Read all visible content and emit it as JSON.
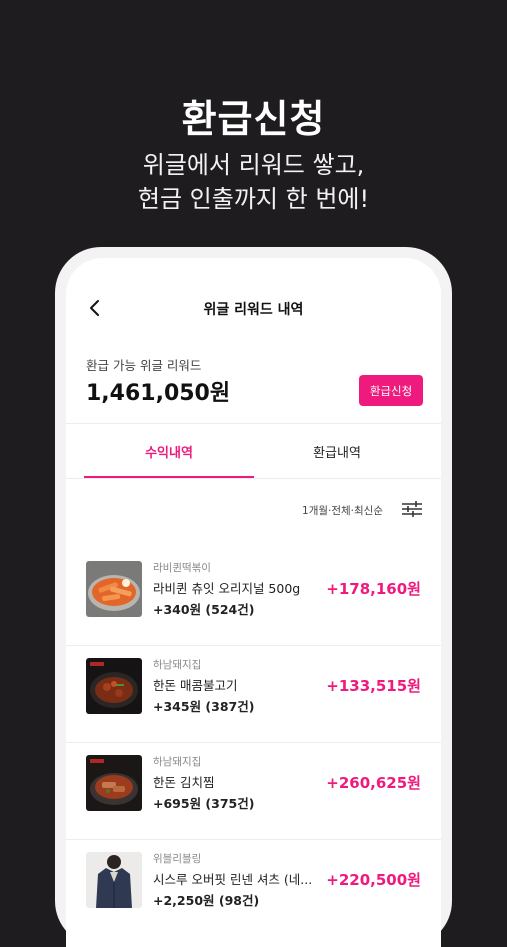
{
  "promo": {
    "title": "환급신청",
    "subtitle_line1": "위글에서 리워드 쌓고,",
    "subtitle_line2": "현금 인출까지 한 번에!"
  },
  "screen": {
    "nav_title": "위글 리워드 내역",
    "balance_label": "환급 가능 위글 리워드",
    "balance_amount": "1,461,050원",
    "refund_button": "환급신청",
    "tabs": [
      {
        "label": "수익내역",
        "active": true
      },
      {
        "label": "환급내역",
        "active": false
      }
    ],
    "filter_label": "1개월·전체·최신순",
    "items": [
      {
        "store": "라비퀸떡볶이",
        "product": "라비퀸 츄잇 오리지널 500g",
        "unit": "+340원 (524건)",
        "total": "+178,160원",
        "thumb": "tteokbokki-photo"
      },
      {
        "store": "하남돼지집",
        "product": "한돈 매콤불고기",
        "unit": "+345원 (387건)",
        "total": "+133,515원",
        "thumb": "bulgogi-photo"
      },
      {
        "store": "하남돼지집",
        "product": "한돈 김치찜",
        "unit": "+695원 (375건)",
        "total": "+260,625원",
        "thumb": "kimchi-jjim-photo"
      },
      {
        "store": "위블리블링",
        "product": "시스루 오버핏 린넨 셔츠 (네...",
        "unit": "+2,250원 (98건)",
        "total": "+220,500원",
        "thumb": "shirt-photo"
      }
    ],
    "accent_color": "#ef1a7d",
    "background_color": "#1e1c1f"
  }
}
